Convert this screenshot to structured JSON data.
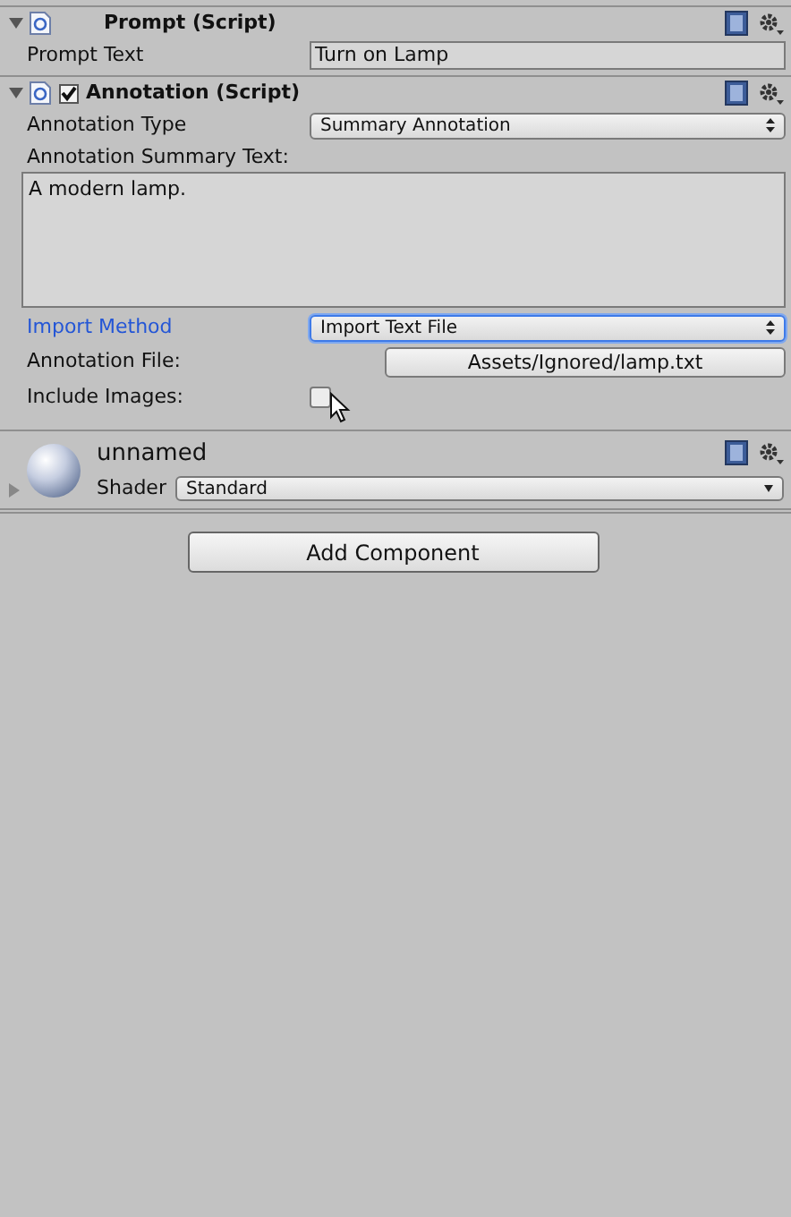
{
  "components": [
    {
      "title": "Prompt (Script)",
      "expanded": true,
      "fields": [
        {
          "kind": "text",
          "label": "Prompt Text",
          "value": "Turn on Lamp",
          "focused": false
        }
      ]
    },
    {
      "title": "Annotation (Script)",
      "expanded": true,
      "enabled": true,
      "fields": [
        {
          "kind": "dropdown",
          "label": "Annotation Type",
          "value": "Summary Annotation",
          "focused": false
        },
        {
          "kind": "textarea",
          "label": "Annotation Summary Text:",
          "value": "A modern lamp.",
          "focused": false
        },
        {
          "kind": "dropdown",
          "label": "Import Method",
          "value": "Import Text File",
          "focused": true
        },
        {
          "kind": "file",
          "label": "Annotation File:",
          "value": "Assets/Ignored/lamp.txt",
          "focused": false
        },
        {
          "kind": "checkbox",
          "label": "Include Images:",
          "checked": false,
          "focused": false
        }
      ]
    }
  ],
  "material": {
    "name": "unnamed",
    "expanded": false,
    "shader_label": "Shader",
    "shader": "Standard"
  },
  "add_component": "Add Component"
}
